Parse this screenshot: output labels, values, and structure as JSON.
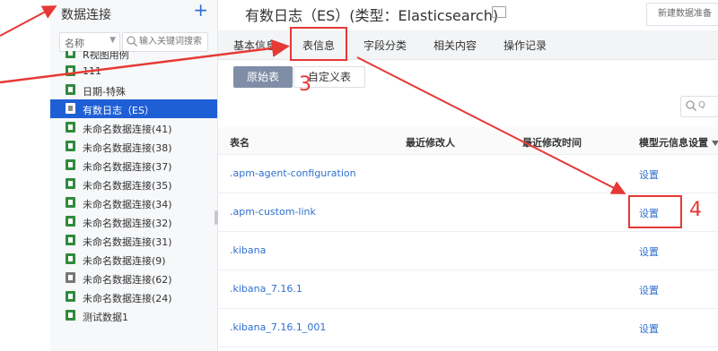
{
  "sidebar": {
    "title": "数据连接",
    "add_label": "+",
    "filter_label": "名称",
    "search_placeholder": "输入关键词搜索",
    "items": [
      {
        "label": "R视图用例",
        "icon": "spreadsheet-icon"
      },
      {
        "label": "111",
        "icon": "spreadsheet-icon"
      },
      {
        "label": "日期-特殊",
        "icon": "spreadsheet-icon"
      },
      {
        "label": "有数日志（ES）",
        "icon": "database-icon",
        "active": true
      },
      {
        "label": "未命名数据连接(41)",
        "icon": "spreadsheet-icon"
      },
      {
        "label": "未命名数据连接(38)",
        "icon": "spreadsheet-icon"
      },
      {
        "label": "未命名数据连接(37)",
        "icon": "spreadsheet-icon"
      },
      {
        "label": "未命名数据连接(35)",
        "icon": "spreadsheet-icon"
      },
      {
        "label": "未命名数据连接(34)",
        "icon": "spreadsheet-icon"
      },
      {
        "label": "未命名数据连接(32)",
        "icon": "spreadsheet-icon"
      },
      {
        "label": "未命名数据连接(31)",
        "icon": "spreadsheet-icon"
      },
      {
        "label": "未命名数据连接(9)",
        "icon": "spreadsheet-icon"
      },
      {
        "label": "未命名数据连接(62)",
        "icon": "database-icon"
      },
      {
        "label": "未命名数据连接(24)",
        "icon": "spreadsheet-icon"
      },
      {
        "label": "测试数据1",
        "icon": "spreadsheet-icon"
      }
    ]
  },
  "header": {
    "title": "有数日志（ES）(类型：Elasticsearch)",
    "new_button": "新建数据准备"
  },
  "tabs": [
    {
      "label": "基本信息"
    },
    {
      "label": "表信息",
      "active": true
    },
    {
      "label": "字段分类"
    },
    {
      "label": "相关内容"
    },
    {
      "label": "操作记录"
    }
  ],
  "sub_buttons": {
    "original": "原始表",
    "custom": "自定义表"
  },
  "table_search_placeholder": "Q",
  "table": {
    "headers": {
      "name": "表名",
      "modifier": "最近修改人",
      "modified_time": "最近修改时间",
      "meta_setting": "模型元信息设置"
    },
    "rows": [
      {
        "name": ".apm-agent-configuration",
        "action": "设置"
      },
      {
        "name": ".apm-custom-link",
        "action": "设置"
      },
      {
        "name": ".kibana",
        "action": "设置"
      },
      {
        "name": ".kibana_7.16.1",
        "action": "设置"
      },
      {
        "name": ".kibana_7.16.1_001",
        "action": "设置"
      }
    ]
  },
  "annotations": {
    "step3": "3",
    "step4": "4",
    "color": "#e53935"
  },
  "colors": {
    "active_item": "#1f5fd6",
    "link": "#2f6fcf",
    "primary_button": "#7f8ea6"
  }
}
